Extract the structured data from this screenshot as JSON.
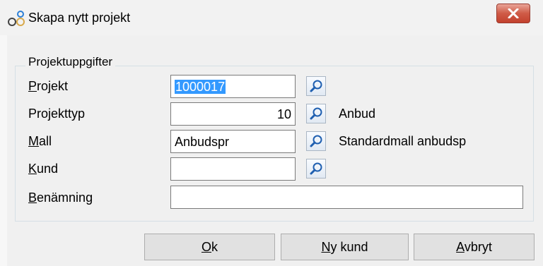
{
  "window": {
    "title": "Skapa nytt projekt",
    "close_icon": "close-icon",
    "app_icon": "project-icon"
  },
  "group": {
    "legend": "Projektuppgifter"
  },
  "rows": {
    "projekt": {
      "label_first": "P",
      "label_rest": "rojekt",
      "value": "1000017",
      "selected": true
    },
    "projekttyp": {
      "label": "Projekttyp",
      "value": "10",
      "description": "Anbud"
    },
    "mall": {
      "label_first": "M",
      "label_rest": "all",
      "value": "Anbudspr",
      "description": "Standardmall anbudsp"
    },
    "kund": {
      "label_first": "K",
      "label_rest": "und",
      "value": ""
    },
    "benamning": {
      "label_first": "B",
      "label_rest": "enämning",
      "value": ""
    }
  },
  "buttons": {
    "ok": {
      "first": "O",
      "rest": "k"
    },
    "ny_kund": {
      "first": "N",
      "rest": "y kund"
    },
    "avbryt": {
      "first": "A",
      "rest": "vbryt"
    }
  },
  "lookup_icon": "magnifier-icon",
  "colors": {
    "close_button": "#c3412d",
    "selection": "#3399ff",
    "dialog_background": "#f0f0f0"
  }
}
